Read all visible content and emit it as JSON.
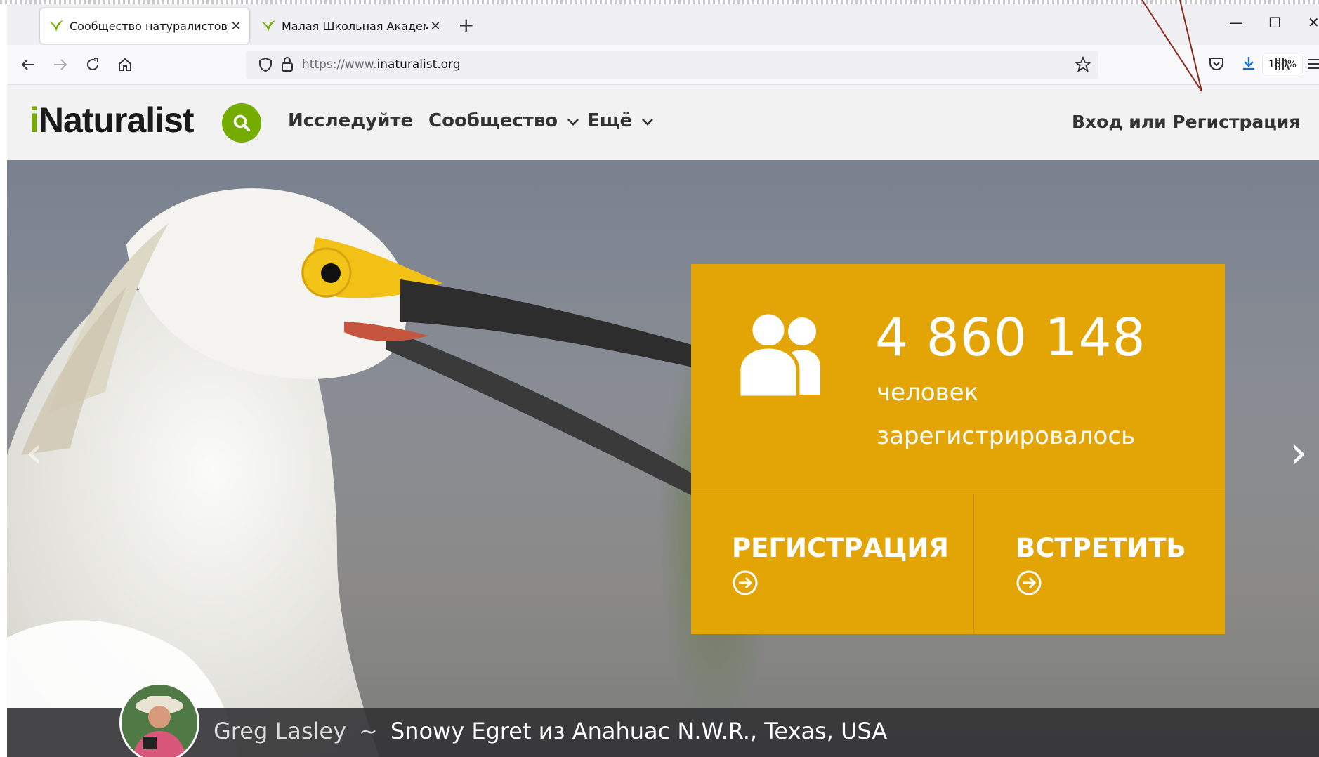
{
  "browser": {
    "tabs": [
      {
        "title": "Сообщество натуралистов · iN",
        "active": true
      },
      {
        "title": "Малая Школьная Академия · iN",
        "active": false
      }
    ],
    "url": {
      "protocol": "https://www.",
      "host": "inaturalist.org"
    },
    "zoom": "150%"
  },
  "site": {
    "logo_i": "i",
    "logo_rest": "Naturalist",
    "nav": {
      "explore": "Исследуйте",
      "community": "Сообщество",
      "more": "Ещё"
    },
    "login": "Вход или Регистрация"
  },
  "hero": {
    "count": "4 860 148",
    "caption_line1": "человек",
    "caption_line2": "зарегистрировалось",
    "signup": "РЕГИСТРАЦИЯ",
    "meet": "ВСТРЕТИТЬ",
    "photographer": "Greg Lasley",
    "separator": "~",
    "photo_caption": "Snowy Egret из Anahuac N.W.R., Texas, USA"
  },
  "colors": {
    "brand_green": "#74ac00",
    "stats_panel": "#e3a406"
  }
}
